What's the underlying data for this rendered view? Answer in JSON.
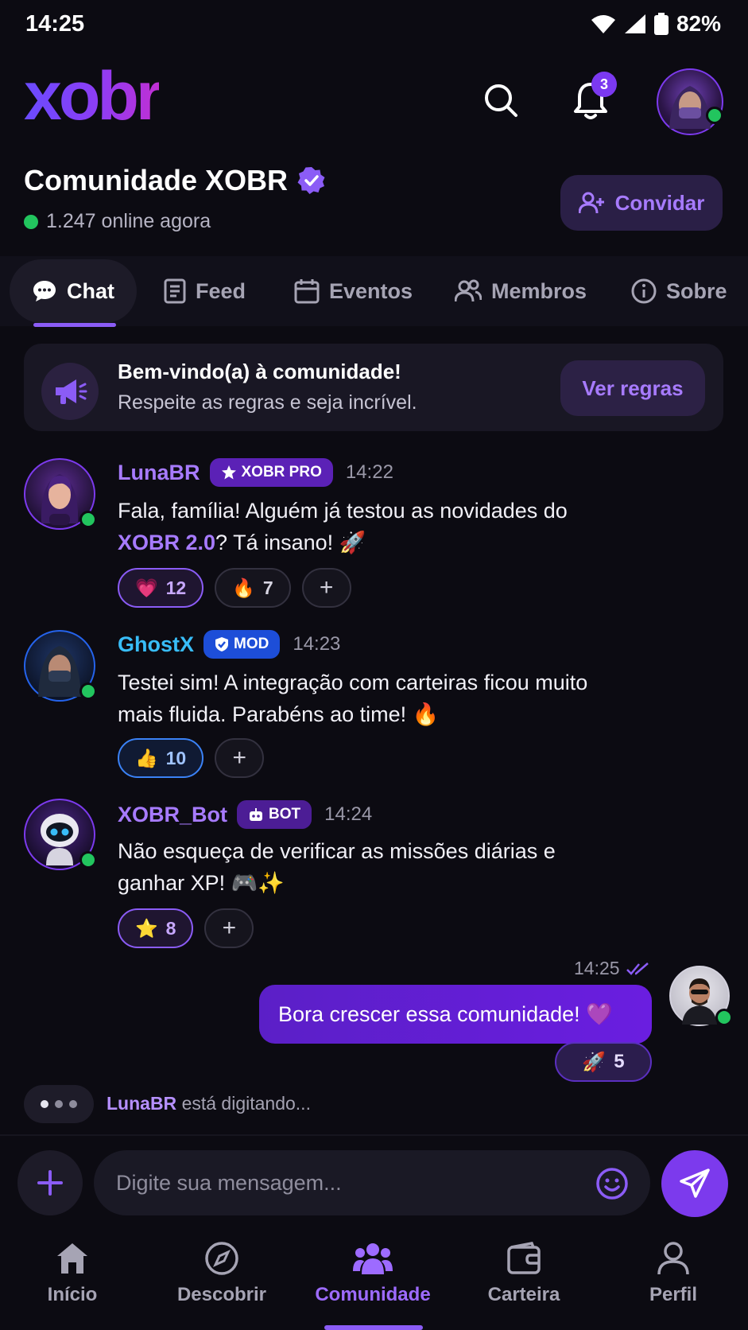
{
  "status_bar": {
    "time": "14:25",
    "battery": "82%"
  },
  "header": {
    "logo": "xobr",
    "notification_count": "3"
  },
  "community": {
    "title": "Comunidade XOBR",
    "online": "1.247 online agora",
    "invite_label": "Convidar"
  },
  "tabs": [
    {
      "label": "Chat",
      "icon": "chat-bubble-icon",
      "active": true
    },
    {
      "label": "Feed",
      "icon": "document-icon"
    },
    {
      "label": "Eventos",
      "icon": "calendar-icon"
    },
    {
      "label": "Membros",
      "icon": "users-icon"
    },
    {
      "label": "Sobre",
      "icon": "info-icon"
    }
  ],
  "welcome": {
    "title": "Bem-vindo(a) à comunidade!",
    "subtitle": "Respeite as regras e seja incrível.",
    "button": "Ver regras"
  },
  "messages": [
    {
      "user": "LunaBR",
      "badge": "XOBR PRO",
      "time": "14:22",
      "text_before": "Fala, família! Alguém já testou as novidades do",
      "text_highlight": "XOBR 2.0",
      "text_after": "? Tá insano! 🚀",
      "reactions": [
        {
          "emoji": "💗",
          "count": "12"
        },
        {
          "emoji": "🔥",
          "count": "7"
        }
      ]
    },
    {
      "user": "GhostX",
      "badge": "MOD",
      "time": "14:23",
      "text_line1": "Testei sim! A integração com carteiras ficou muito",
      "text_line2": "mais fluida. Parabéns ao time! 🔥",
      "reactions": [
        {
          "emoji": "👍",
          "count": "10"
        }
      ]
    },
    {
      "user": "XOBR_Bot",
      "badge": "BOT",
      "time": "14:24",
      "text_line1": "Não esqueça de verificar as missões diárias e",
      "text_line2": "ganhar XP! 🎮✨",
      "reactions": [
        {
          "emoji": "⭐",
          "count": "8"
        }
      ]
    }
  ],
  "own_message": {
    "time": "14:25",
    "text": "Bora crescer essa comunidade! 💜",
    "reaction_emoji": "🚀",
    "reaction_count": "5"
  },
  "typing": {
    "user": "LunaBR",
    "text": "está digitando..."
  },
  "composer": {
    "placeholder": "Digite sua mensagem..."
  },
  "nav": [
    {
      "label": "Início",
      "icon": "home-icon"
    },
    {
      "label": "Descobrir",
      "icon": "compass-icon"
    },
    {
      "label": "Comunidade",
      "icon": "community-icon",
      "active": true
    },
    {
      "label": "Carteira",
      "icon": "wallet-icon"
    },
    {
      "label": "Perfil",
      "icon": "profile-icon"
    }
  ],
  "colors": {
    "accent": "#7c3aed",
    "background": "#0c0b12",
    "online": "#22c55e",
    "mod_blue": "#1d4ed8",
    "luna_name": "#a77bff",
    "ghost_name": "#38bdf8"
  }
}
